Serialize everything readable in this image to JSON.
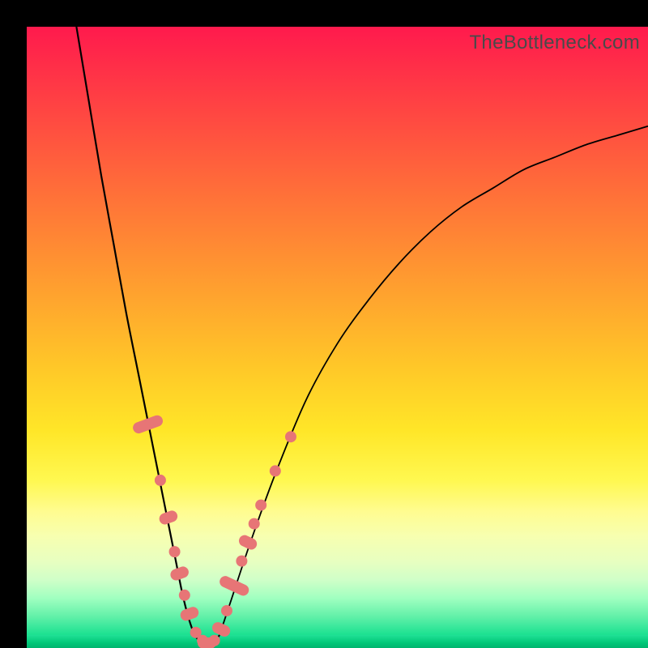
{
  "watermark": "TheBottleneck.com",
  "colors": {
    "marker": "#e77576",
    "curve": "#000000",
    "gradient_top": "#ff1a4d",
    "gradient_bottom": "#00c878"
  },
  "chart_data": {
    "type": "line",
    "title": "",
    "xlabel": "",
    "ylabel": "",
    "xlim": [
      0,
      100
    ],
    "ylim": [
      0,
      100
    ],
    "grid": false,
    "legend": false,
    "annotations": [
      "TheBottleneck.com"
    ],
    "note": "Bottleneck V-curve. Axes unlabeled; x treated as relative component score 0–100, y as bottleneck % 0–100. Values estimated from pixel positions against the full plot area.",
    "series": [
      {
        "name": "left-branch",
        "x": [
          8,
          10,
          12,
          14,
          16,
          18,
          20,
          22,
          24,
          25,
          26,
          27
        ],
        "y": [
          100,
          88,
          76,
          65,
          54,
          44,
          34,
          24,
          14,
          9,
          5,
          2
        ]
      },
      {
        "name": "valley",
        "x": [
          27,
          28,
          29,
          30,
          31
        ],
        "y": [
          2,
          1,
          0.5,
          1,
          2
        ]
      },
      {
        "name": "right-branch",
        "x": [
          31,
          33,
          36,
          40,
          45,
          50,
          55,
          60,
          65,
          70,
          75,
          80,
          85,
          90,
          95,
          100
        ],
        "y": [
          2,
          8,
          17,
          28,
          40,
          49,
          56,
          62,
          67,
          71,
          74,
          77,
          79,
          81,
          82.5,
          84
        ]
      }
    ],
    "markers": [
      {
        "x": 19.5,
        "y": 36,
        "kind": "capsule",
        "len": 5
      },
      {
        "x": 21.5,
        "y": 27,
        "kind": "dot"
      },
      {
        "x": 22.8,
        "y": 21,
        "kind": "capsule",
        "len": 3
      },
      {
        "x": 23.8,
        "y": 15.5,
        "kind": "dot"
      },
      {
        "x": 24.6,
        "y": 12,
        "kind": "capsule",
        "len": 3
      },
      {
        "x": 25.4,
        "y": 8.5,
        "kind": "dot"
      },
      {
        "x": 26.2,
        "y": 5.5,
        "kind": "capsule",
        "len": 3
      },
      {
        "x": 27.2,
        "y": 2.5,
        "kind": "dot"
      },
      {
        "x": 28.3,
        "y": 1.2,
        "kind": "dot"
      },
      {
        "x": 29.0,
        "y": 0.8,
        "kind": "capsule-h",
        "len": 3
      },
      {
        "x": 30.2,
        "y": 1.2,
        "kind": "dot"
      },
      {
        "x": 31.3,
        "y": 3,
        "kind": "capsule",
        "len": 3
      },
      {
        "x": 32.2,
        "y": 6,
        "kind": "dot"
      },
      {
        "x": 33.4,
        "y": 10,
        "kind": "capsule",
        "len": 5
      },
      {
        "x": 34.6,
        "y": 14,
        "kind": "dot"
      },
      {
        "x": 35.6,
        "y": 17,
        "kind": "capsule",
        "len": 3
      },
      {
        "x": 36.6,
        "y": 20,
        "kind": "dot"
      },
      {
        "x": 37.7,
        "y": 23,
        "kind": "dot"
      },
      {
        "x": 40.0,
        "y": 28.5,
        "kind": "dot"
      },
      {
        "x": 42.5,
        "y": 34,
        "kind": "dot"
      }
    ]
  }
}
